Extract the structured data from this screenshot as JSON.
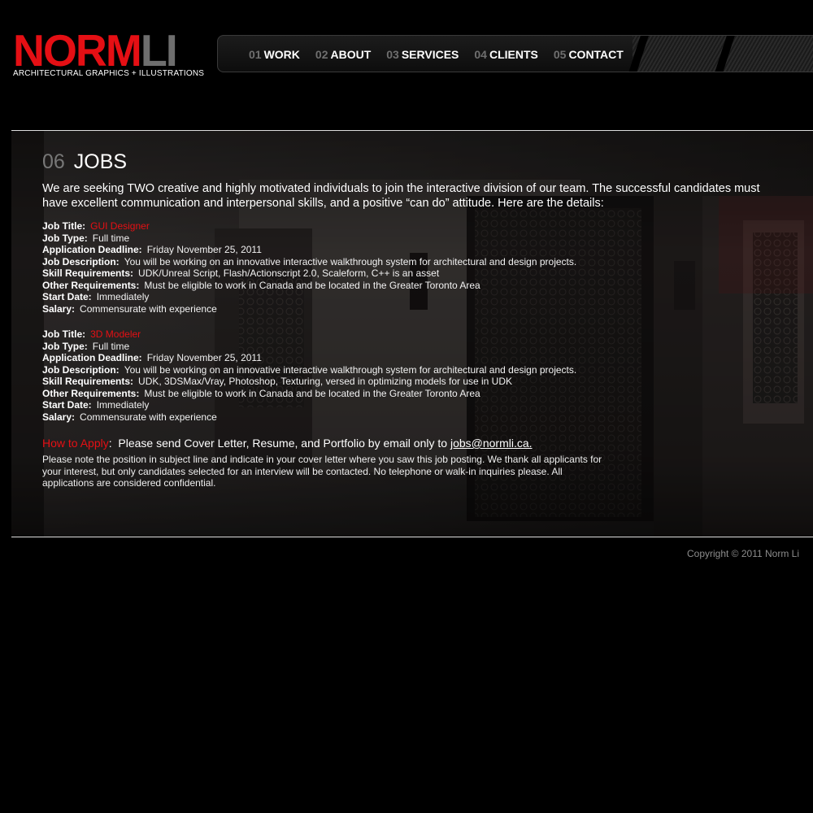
{
  "logo": {
    "norm": "NORM",
    "li": "LI",
    "tagline": "ARCHITECTURAL GRAPHICS + ILLUSTRATIONS"
  },
  "nav": [
    {
      "num": "01",
      "label": "WORK"
    },
    {
      "num": "02",
      "label": "ABOUT"
    },
    {
      "num": "03",
      "label": "SERVICES"
    },
    {
      "num": "04",
      "label": "CLIENTS"
    },
    {
      "num": "05",
      "label": "CONTACT"
    }
  ],
  "page": {
    "num": "06",
    "title": "JOBS",
    "intro": "We are seeking TWO creative and highly motivated individuals to join the interactive division of our team.  The successful candidates must have excellent communication and interpersonal skills, and a positive “can do” attitude.  Here are the details:"
  },
  "labels": {
    "job_title": "Job Title:",
    "job_type": "Job Type:",
    "deadline": "Application Deadline:",
    "description": "Job Description:",
    "skills": "Skill Requirements:",
    "other": "Other Requirements:",
    "start": "Start Date:",
    "salary": "Salary:"
  },
  "jobs": [
    {
      "title": "GUI Designer",
      "type": "Full time",
      "deadline": "Friday November 25, 2011",
      "description": "You will be working on an innovative interactive walkthrough system for architectural and design projects.",
      "skills": "UDK/Unreal Script, Flash/Actionscript 2.0, Scaleform, C++ is an asset",
      "other": "Must be eligible to work in Canada and be located in the Greater Toronto Area",
      "start": "Immediately",
      "salary": "Commensurate with experience"
    },
    {
      "title": "3D Modeler",
      "type": "Full time",
      "deadline": "Friday November 25, 2011",
      "description": "You will be working on an innovative interactive walkthrough system for architectural and design projects.",
      "skills": "UDK, 3DSMax/Vray, Photoshop, Texturing, versed in optimizing models for use in UDK",
      "other": "Must be eligible to work in Canada and be located in the Greater Toronto Area",
      "start": "Immediately",
      "salary": "Commensurate with experience"
    }
  ],
  "apply": {
    "label": "How to Apply",
    "colon": ":",
    "text": "Please send Cover Letter, Resume, and Portfolio by email only to",
    "email": "jobs@normli.ca.",
    "note": "Please note the position in subject line and indicate in your cover letter where you saw this job posting.  We thank all applicants for your interest, but only candidates selected for an interview will be contacted.  No telephone or walk-in inquiries please.  All applications are considered confidential."
  },
  "footer": {
    "copyright": "Copyright © 2011 Norm Li"
  },
  "colors": {
    "brand_red": "#e50f14",
    "logo_gray": "#6e6e6e",
    "nav_number_gray": "#6f6f6f"
  }
}
